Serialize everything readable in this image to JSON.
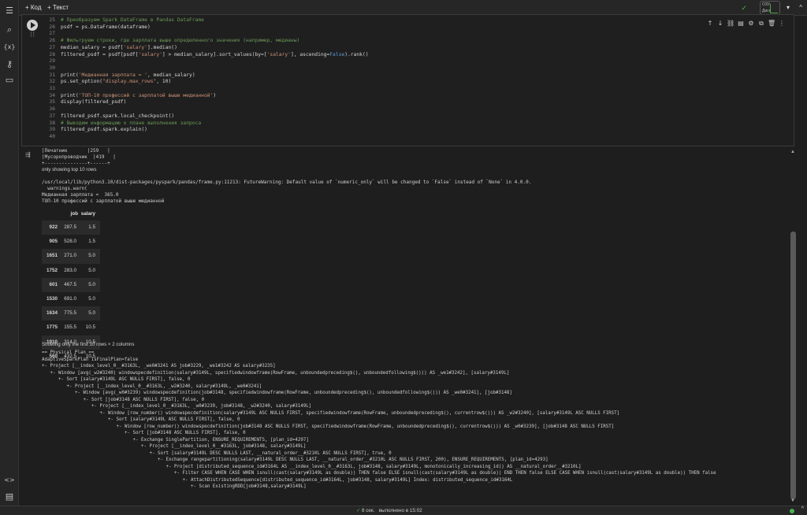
{
  "toolbar": {
    "add_code": "+ Код",
    "add_text": "+ Текст",
    "ram_label": "ОЗУ",
    "disk_label": "Диск",
    "menu_chevron": "▾",
    "collapse_chevron": "^"
  },
  "sidebar": {
    "items": [
      {
        "name": "menu-icon",
        "glyph": "☰"
      },
      {
        "name": "search-icon",
        "glyph": "⌕"
      },
      {
        "name": "variables-icon",
        "glyph": "{x}"
      },
      {
        "name": "secrets-icon",
        "glyph": "⚷"
      },
      {
        "name": "files-icon",
        "glyph": "▭"
      }
    ],
    "bottom": [
      {
        "name": "code-snippets-icon",
        "glyph": "<>"
      },
      {
        "name": "terminal-icon",
        "glyph": "▤"
      }
    ]
  },
  "cell": {
    "exec_count": "[ ]",
    "tools": [
      "↑",
      "↓",
      "⛓",
      "▤",
      "⚙",
      "⧉",
      "🗑",
      "⋮"
    ],
    "lines": [
      {
        "n": "25",
        "parts": [
          {
            "t": "# Преобразуем Spark DataFrame в Pandas DataFrame",
            "c": "cm"
          }
        ]
      },
      {
        "n": "26",
        "parts": [
          {
            "t": "psdf = ps.DataFrame(dataframe)",
            "c": ""
          }
        ]
      },
      {
        "n": "27",
        "parts": [
          {
            "t": "",
            "c": ""
          }
        ]
      },
      {
        "n": "26",
        "parts": [
          {
            "t": "# Фильтруем строки, где зарплата выше определенного значения (например, медианы)",
            "c": "cm"
          }
        ]
      },
      {
        "n": "27",
        "parts": [
          {
            "t": "median_salary = psdf[",
            "c": ""
          },
          {
            "t": "'salary'",
            "c": "str"
          },
          {
            "t": "].median()",
            "c": ""
          }
        ]
      },
      {
        "n": "28",
        "parts": [
          {
            "t": "filtered_psdf = psdf[psdf[",
            "c": ""
          },
          {
            "t": "'salary'",
            "c": "str"
          },
          {
            "t": "] > median_salary].sort_values(by=[",
            "c": ""
          },
          {
            "t": "'salary'",
            "c": "str"
          },
          {
            "t": "], ascending=",
            "c": ""
          },
          {
            "t": "False",
            "c": "kw"
          },
          {
            "t": ").rank()",
            "c": ""
          }
        ]
      },
      {
        "n": "29",
        "parts": [
          {
            "t": "",
            "c": ""
          }
        ]
      },
      {
        "n": "30",
        "parts": [
          {
            "t": "",
            "c": ""
          }
        ]
      },
      {
        "n": "31",
        "parts": [
          {
            "t": "print(",
            "c": ""
          },
          {
            "t": "'Медианная зарплата = '",
            "c": "str"
          },
          {
            "t": ", median_salary)",
            "c": ""
          }
        ]
      },
      {
        "n": "32",
        "parts": [
          {
            "t": "ps.set_option(",
            "c": ""
          },
          {
            "t": "\"display.max_rows\"",
            "c": "str"
          },
          {
            "t": ", 10)",
            "c": ""
          }
        ]
      },
      {
        "n": "33",
        "parts": [
          {
            "t": "",
            "c": ""
          }
        ]
      },
      {
        "n": "34",
        "parts": [
          {
            "t": "print(",
            "c": ""
          },
          {
            "t": "'ТОП-10 профессий с зарплатой выше медианной'",
            "c": "str"
          },
          {
            "t": ")",
            "c": ""
          }
        ]
      },
      {
        "n": "35",
        "parts": [
          {
            "t": "display(filtered_psdf)",
            "c": ""
          }
        ]
      },
      {
        "n": "36",
        "parts": [
          {
            "t": "",
            "c": ""
          }
        ]
      },
      {
        "n": "37",
        "parts": [
          {
            "t": "filtered_psdf.spark.local_checkpoint()",
            "c": ""
          }
        ]
      },
      {
        "n": "38",
        "parts": [
          {
            "t": "# Выводим информацию о плане выполнения запроса",
            "c": "cm"
          }
        ]
      },
      {
        "n": "39",
        "parts": [
          {
            "t": "filtered_psdf.spark.explain()",
            "c": ""
          }
        ]
      },
      {
        "n": "40",
        "parts": [
          {
            "t": "",
            "c": ""
          }
        ]
      }
    ]
  },
  "output": {
    "pre_lines": [
      "|Печатник       |259   |",
      "|Мусоропроводчик  |419   |",
      "+---------------+------+",
      "only showing top 10 rows",
      "",
      "/usr/local/lib/python3.10/dist-packages/pyspark/pandas/frame.py:11213: FutureWarning: Default value of `numeric_only` will be changed to `False` instead of `None` in 4.0.0.",
      "  warnings.warn(",
      "Медианная зарплата =  365.0",
      "ТОП-10 профессий с зарплатой выше медианной"
    ],
    "table": {
      "columns": [
        "job",
        "salary"
      ],
      "rows": [
        [
          "922",
          "287.5",
          "1.5"
        ],
        [
          "905",
          "528.0",
          "1.5"
        ],
        [
          "1651",
          "271.0",
          "5.0"
        ],
        [
          "1752",
          "283.0",
          "5.0"
        ],
        [
          "601",
          "467.5",
          "5.0"
        ],
        [
          "1530",
          "691.0",
          "5.0"
        ],
        [
          "1634",
          "775.5",
          "5.0"
        ],
        [
          "1775",
          "155.5",
          "10.5"
        ],
        [
          "1910",
          "314.0",
          "10.5"
        ],
        [
          "560",
          "432.5",
          "10.5"
        ]
      ],
      "note": "Showing only the first 10 rows × 2 columns"
    },
    "plan": [
      {
        "i": 0,
        "t": "== Physical Plan =="
      },
      {
        "i": 0,
        "t": "AdaptiveSparkPlan isFinalPlan=false"
      },
      {
        "i": 0,
        "t": "+- Project [__index_level_0__#3163L, _we0#3241 AS job#3229, _we1#3242 AS salary#3235]"
      },
      {
        "i": 1,
        "t": "+- Window [avg(_w2#3240) windowspecdefinition(salary#3149L, specifiedwindowframe(RowFrame, unboundedpreceding$(), unboundedfollowing$())) AS _we1#3242], [salary#3149L]"
      },
      {
        "i": 2,
        "t": "+- Sort [salary#3149L ASC NULLS FIRST], false, 0"
      },
      {
        "i": 3,
        "t": "+- Project [__index_level_0__#3163L, _w2#3240, salary#3149L, _we0#3241]"
      },
      {
        "i": 4,
        "t": "+- Window [avg(_w0#3239) windowspecdefinition(job#3148, specifiedwindowframe(RowFrame, unboundedpreceding$(), unboundedfollowing$())) AS _we0#3241], [job#3148]"
      },
      {
        "i": 5,
        "t": "+- Sort [job#3148 ASC NULLS FIRST], false, 0"
      },
      {
        "i": 6,
        "t": "+- Project [__index_level_0__#3163L, _w0#3239, job#3148, _w2#3240, salary#3149L]"
      },
      {
        "i": 7,
        "t": "+- Window [row_number() windowspecdefinition(salary#3149L ASC NULLS FIRST, specifiedwindowframe(RowFrame, unboundedpreceding$(), currentrow$())) AS _w2#3240], [salary#3149L ASC NULLS FIRST]"
      },
      {
        "i": 8,
        "t": "+- Sort [salary#3149L ASC NULLS FIRST], false, 0"
      },
      {
        "i": 9,
        "t": "+- Window [row_number() windowspecdefinition(job#3148 ASC NULLS FIRST, specifiedwindowframe(RowFrame, unboundedpreceding$(), currentrow$())) AS _w0#3239], [job#3148 ASC NULLS FIRST]"
      },
      {
        "i": 10,
        "t": "+- Sort [job#3148 ASC NULLS FIRST], false, 0"
      },
      {
        "i": 11,
        "t": "+- Exchange SinglePartition, ENSURE_REQUIREMENTS, [plan_id=4297]"
      },
      {
        "i": 12,
        "t": "+- Project [__index_level_0__#3163L, job#3148, salary#3149L]"
      },
      {
        "i": 13,
        "t": "+- Sort [salary#3149L DESC NULLS LAST, __natural_order__#3210L ASC NULLS FIRST], true, 0"
      },
      {
        "i": 14,
        "t": "+- Exchange rangepartitioning(salary#3149L DESC NULLS LAST, __natural_order__#3210L ASC NULLS FIRST, 200), ENSURE_REQUIREMENTS, [plan_id=4293]"
      },
      {
        "i": 15,
        "t": "+- Project [distributed_sequence_id#3164L AS __index_level_0__#3163L, job#3148, salary#3149L, monotonically_increasing_id() AS __natural_order__#3210L]"
      },
      {
        "i": 16,
        "t": "+- Filter CASE WHEN CASE WHEN isnull(cast(salary#3149L as double)) THEN false ELSE isnull(cast(salary#3149L as double)) END THEN false ELSE CASE WHEN isnull(cast(salary#3149L as double)) THEN false"
      },
      {
        "i": 17,
        "t": "+- AttachDistributedSequence[distributed_sequence_id#3164L, job#3148, salary#3149L] Index: distributed_sequence_id#3164L"
      },
      {
        "i": 18,
        "t": "+- Scan ExistingRDD[job#3148,salary#3149L]"
      }
    ]
  },
  "status": {
    "check": "✓",
    "duration": "8 сек.",
    "completed": "выполнено в 15:02"
  },
  "colors": {
    "accent_green": "#4caf50"
  }
}
